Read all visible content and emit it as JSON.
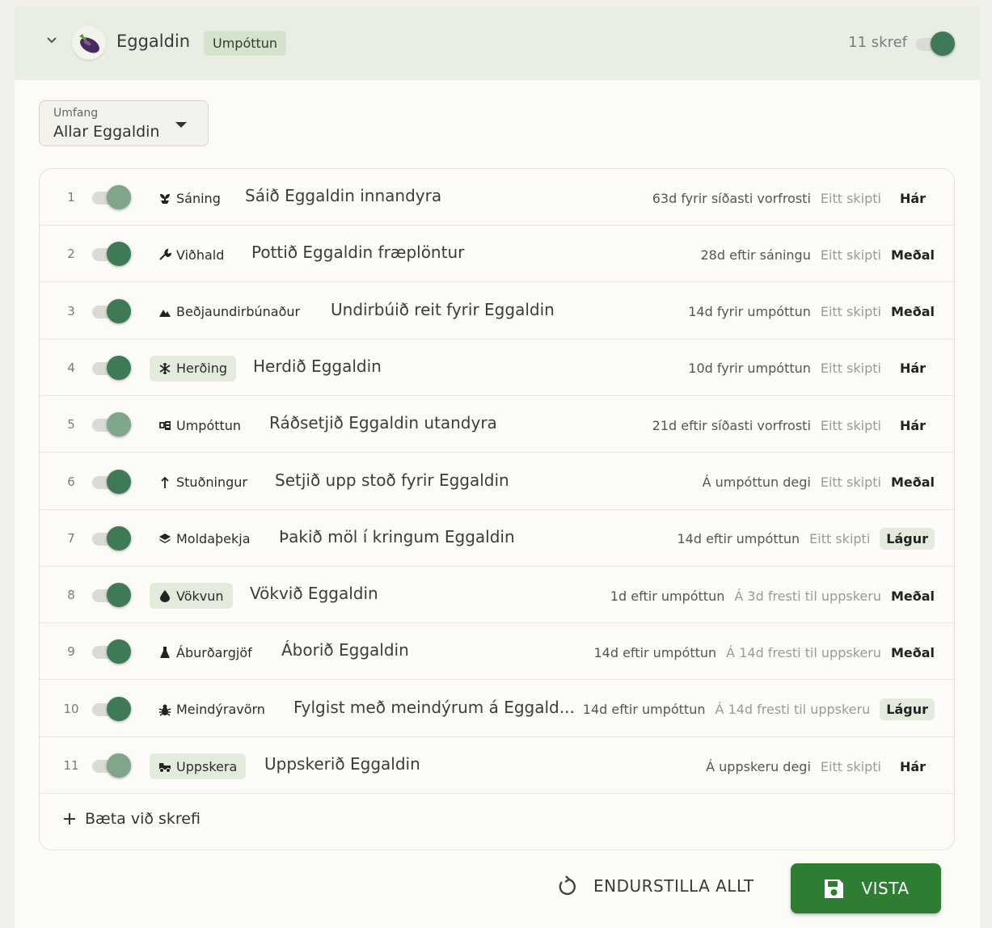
{
  "header": {
    "crop_name": "Eggaldin",
    "stage_badge": "Umpóttun",
    "step_count": "11 skref"
  },
  "scope": {
    "label": "Umfang",
    "value": "Allar Eggaldin"
  },
  "steps": [
    {
      "num": "1",
      "enabled": true,
      "category": "Sáning",
      "icon": "seedling-icon",
      "title": "Sáið Eggaldin innandyra",
      "timing": "63d fyrir síðasti vorfrosti",
      "frequency": "Eitt skipti",
      "priority": "Hár"
    },
    {
      "num": "2",
      "enabled": true,
      "category": "Viðhald",
      "icon": "wrench-icon",
      "title": "Pottið Eggaldin fræplöntur",
      "timing": "28d eftir sáningu",
      "frequency": "Eitt skipti",
      "priority": "Meðal"
    },
    {
      "num": "3",
      "enabled": true,
      "category": "Beðjaundirbúnaður",
      "icon": "terrain-icon",
      "title": "Undirbúið reit fyrir Eggaldin",
      "timing": "14d fyrir umpóttun",
      "frequency": "Eitt skipti",
      "priority": "Meðal"
    },
    {
      "num": "4",
      "enabled": true,
      "category": "Herðing",
      "icon": "snowflake-icon",
      "title": "Herdið Eggaldin",
      "timing": "10d fyrir umpóttun",
      "frequency": "Eitt skipti",
      "priority": "Hár"
    },
    {
      "num": "5",
      "enabled": true,
      "category": "Umpóttun",
      "icon": "transplant-icon",
      "title": "Ráðsetjið Eggaldin utandyra",
      "timing": "21d eftir síðasti vorfrosti",
      "frequency": "Eitt skipti",
      "priority": "Hár"
    },
    {
      "num": "6",
      "enabled": true,
      "category": "Stuðningur",
      "icon": "arrow-up-icon",
      "title": "Setjið upp stoð fyrir Eggaldin",
      "timing": "Á umpóttun degi",
      "frequency": "Eitt skipti",
      "priority": "Meðal"
    },
    {
      "num": "7",
      "enabled": true,
      "category": "Moldaþekja",
      "icon": "layers-icon",
      "title": "Þakið möl í kringum Eggaldin",
      "timing": "14d eftir umpóttun",
      "frequency": "Eitt skipti",
      "priority": "Lágur"
    },
    {
      "num": "8",
      "enabled": true,
      "category": "Vökvun",
      "icon": "water-drop-icon",
      "title": "Vökvið Eggaldin",
      "timing": "1d eftir umpóttun",
      "frequency": "Á 3d fresti til uppskeru",
      "priority": "Meðal"
    },
    {
      "num": "9",
      "enabled": true,
      "category": "Áburðargjöf",
      "icon": "flask-icon",
      "title": "Áborið Eggaldin",
      "timing": "14d eftir umpóttun",
      "frequency": "Á 14d fresti til uppskeru",
      "priority": "Meðal"
    },
    {
      "num": "10",
      "enabled": true,
      "category": "Meindýravörn",
      "icon": "bug-icon",
      "title": "Fylgist með meindýrum á Eggald...",
      "timing": "14d eftir umpóttun",
      "frequency": "Á 14d fresti til uppskeru",
      "priority": "Lágur"
    },
    {
      "num": "11",
      "enabled": true,
      "category": "Uppskera",
      "icon": "harvest-icon",
      "title": "Uppskerið Eggaldin",
      "timing": "Á uppskeru degi",
      "frequency": "Eitt skipti",
      "priority": "Hár"
    }
  ],
  "add_step_label": "Bæta við skrefi",
  "actions": {
    "reset_label": "ENDURSTILLA ALLT",
    "save_label": "VISTA"
  },
  "colors": {
    "accent": "#3f7a56",
    "save_button": "#2f7d32",
    "header_bg": "#e9eee4",
    "badge_bg": "#d6e3cc"
  }
}
